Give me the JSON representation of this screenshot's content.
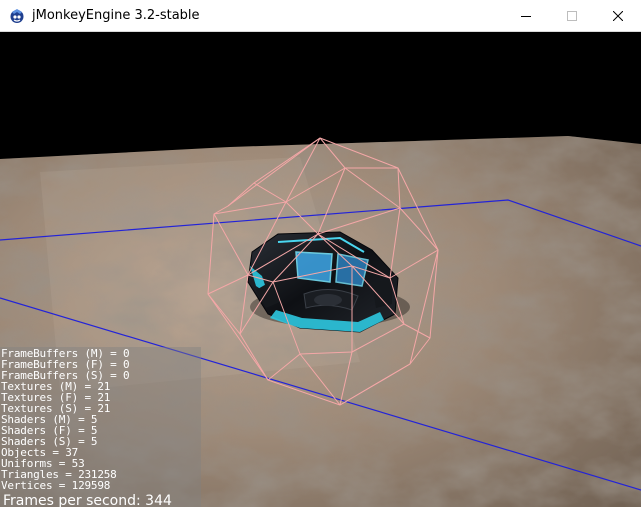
{
  "window": {
    "title": "jMonkeyEngine 3.2-stable"
  },
  "controls": {
    "minimize_icon": "minimize-icon",
    "maximize_icon": "maximize-icon",
    "close_icon": "close-icon"
  },
  "colors": {
    "bounding_sphere_wireframe": "#f4a7a7",
    "floor_grid_line": "#2222dd",
    "vehicle_glow": "#33ddee",
    "stats_text": "#ffffff"
  },
  "stats": [
    "FrameBuffers (M) = 0",
    "FrameBuffers (F) = 0",
    "FrameBuffers (S) = 0",
    "Textures (M) = 21",
    "Textures (F) = 21",
    "Textures (S) = 21",
    "Shaders (M) = 5",
    "Shaders (F) = 5",
    "Shaders (S) = 5",
    "Objects = 37",
    "Uniforms = 53",
    "Triangles = 231258",
    "Vertices = 129598"
  ],
  "fps": "Frames per second: 344"
}
